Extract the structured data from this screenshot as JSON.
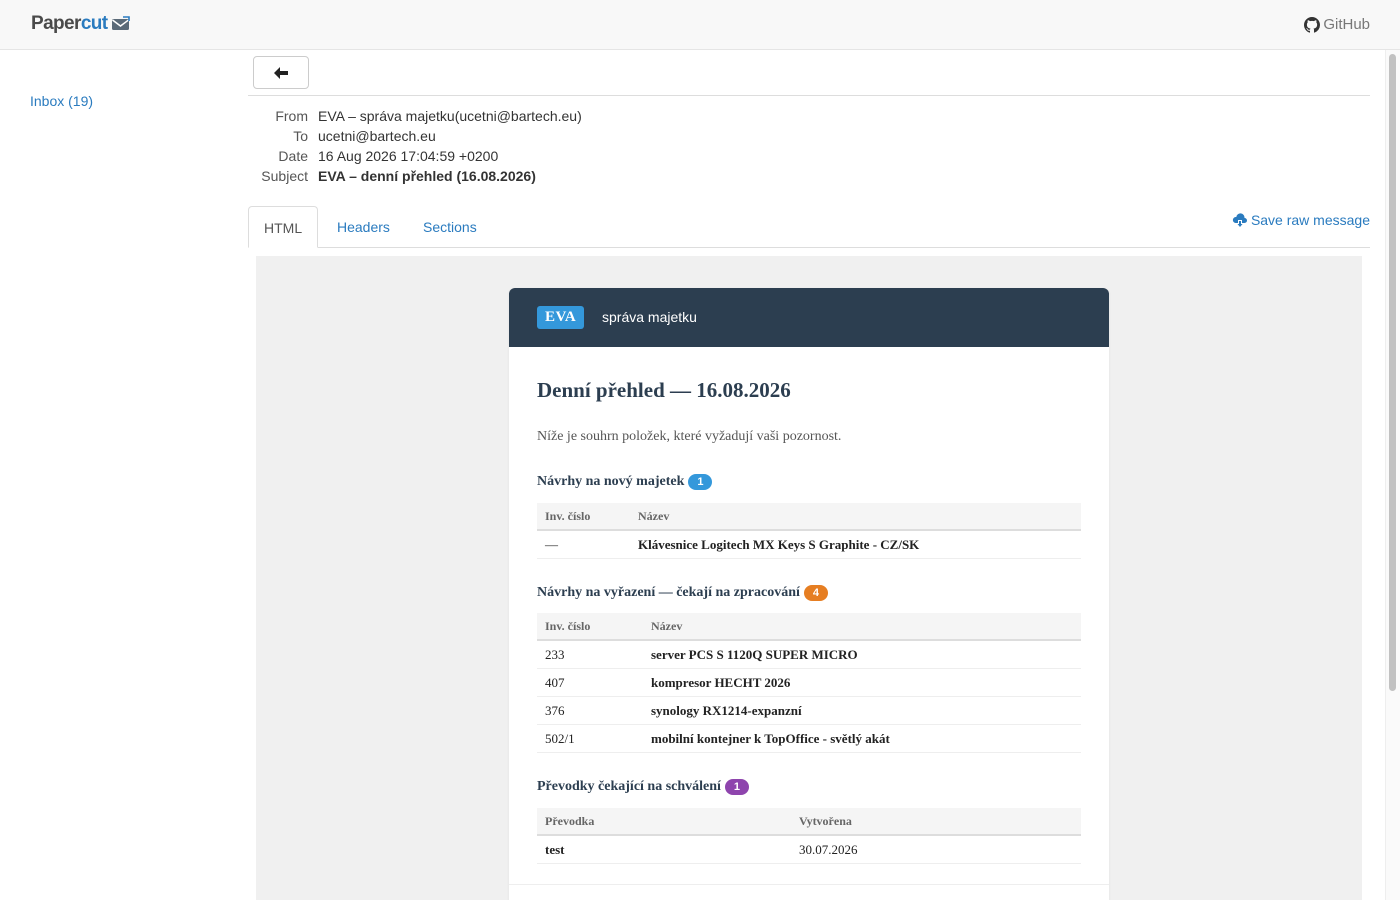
{
  "app": {
    "brand_part1": "Paper",
    "brand_part2": "cut",
    "github_label": "GitHub"
  },
  "sidebar": {
    "inbox_label": "Inbox (19)"
  },
  "message": {
    "labels": {
      "from": "From",
      "to": "To",
      "date": "Date",
      "subject": "Subject"
    },
    "from": "EVA – správa majetku(ucetni@bartech.eu)",
    "to": "ucetni@bartech.eu",
    "date": "16 Aug 2026 17:04:59 +0200",
    "subject": "EVA – denní přehled (16.08.2026)"
  },
  "tabs": [
    {
      "label": "HTML",
      "active": true
    },
    {
      "label": "Headers",
      "active": false
    },
    {
      "label": "Sections",
      "active": false
    }
  ],
  "save_raw_label": "Save raw message",
  "email": {
    "header_badge": "EVA",
    "header_sub": "správa majetku",
    "title": "Denní přehled — 16.08.2026",
    "intro": "Níže je souhrn položek, které vyžadují vaši pozornost.",
    "sections": [
      {
        "title": "Návrhy na nový majetek",
        "count": "1",
        "count_color": "#3498db",
        "columns": [
          "Inv. číslo",
          "Název"
        ],
        "rows": [
          [
            "—",
            "Klávesnice Logitech MX Keys S Graphite - CZ/SK"
          ]
        ]
      },
      {
        "title": "Návrhy na vyřazení — čekají na zpracování",
        "count": "4",
        "count_color": "#e67e22",
        "columns": [
          "Inv. číslo",
          "Název"
        ],
        "rows": [
          [
            "233",
            "server PCS S 1120Q SUPER MICRO"
          ],
          [
            "407",
            "kompresor HECHT 2026"
          ],
          [
            "376",
            "synology RX1214-expanzní"
          ],
          [
            "502/1",
            "mobilní kontejner k TopOffice - světlý akát"
          ]
        ]
      },
      {
        "title": "Převodky čekající na schválení",
        "count": "1",
        "count_color": "#8e44ad",
        "columns": [
          "Převodka",
          "Vytvořena"
        ],
        "rows": [
          [
            "test",
            "30.07.2026"
          ]
        ]
      }
    ]
  },
  "icons": {
    "brand": "envelope-icon",
    "github": "github-icon",
    "back": "arrow-left-icon",
    "save": "cloud-download-icon"
  }
}
